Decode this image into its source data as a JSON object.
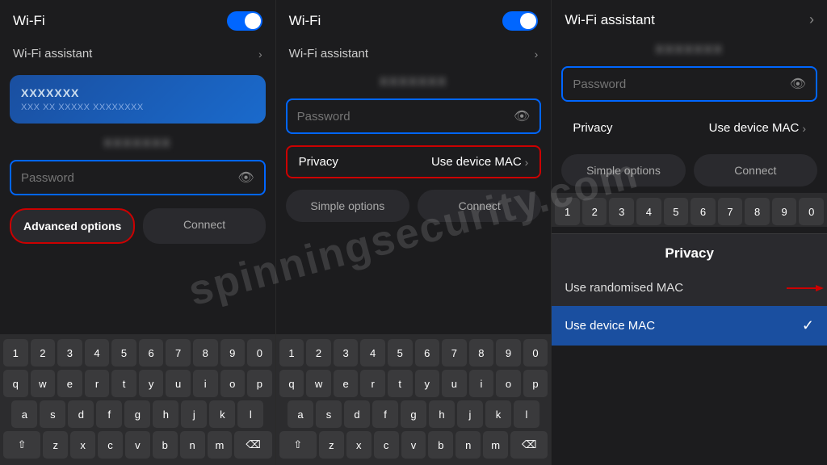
{
  "watermark": "spinningsecurity.com",
  "panel1": {
    "top_bar_title": "Wi-Fi",
    "assistant_label": "Wi-Fi assistant",
    "network_name": "XXXXXXX",
    "network_sub": "XXX XX XXXXX XXXXXXXX",
    "password_placeholder": "Password",
    "advanced_options_label": "Advanced options",
    "connect_label": "Connect",
    "numbers": [
      "1",
      "2",
      "3",
      "4",
      "5",
      "6",
      "7",
      "8",
      "9",
      "0"
    ],
    "row2": [
      "q",
      "w",
      "e",
      "r",
      "t",
      "y",
      "u",
      "i",
      "o",
      "p"
    ],
    "row3": [
      "a",
      "s",
      "d",
      "f",
      "g",
      "h",
      "j",
      "k",
      "l"
    ],
    "row4": [
      "z",
      "x",
      "c",
      "v",
      "b",
      "n",
      "m"
    ]
  },
  "panel2": {
    "top_bar_title": "Wi-Fi",
    "assistant_label": "Wi-Fi assistant",
    "network_name": "XXXXXXX",
    "password_placeholder": "Password",
    "privacy_label": "Privacy",
    "privacy_value": "Use device MAC",
    "simple_options_label": "Simple options",
    "connect_label": "Connect",
    "numbers": [
      "1",
      "2",
      "3",
      "4",
      "5",
      "6",
      "7",
      "8",
      "9",
      "0"
    ],
    "row2": [
      "q",
      "w",
      "e",
      "r",
      "t",
      "y",
      "u",
      "i",
      "o",
      "p"
    ],
    "row3": [
      "a",
      "s",
      "d",
      "f",
      "g",
      "h",
      "j",
      "k",
      "l"
    ],
    "row4": [
      "z",
      "x",
      "c",
      "v",
      "b",
      "n",
      "m"
    ]
  },
  "panel3": {
    "top_bar_title": "Wi-Fi assistant",
    "network_name": "XXXXXXX",
    "password_placeholder": "Password",
    "privacy_label": "Privacy",
    "privacy_value": "Use device MAC",
    "simple_options_label": "Simple options",
    "connect_label": "Connect",
    "privacy_section_title": "Privacy",
    "option_randomised": "Use randomised MAC",
    "option_device": "Use device MAC",
    "numbers": [
      "1",
      "2",
      "3",
      "4",
      "5",
      "6",
      "7",
      "8",
      "9",
      "0"
    ]
  },
  "colors": {
    "accent": "#0066ff",
    "highlight": "#cc0000",
    "selected_bg": "#1a4fa0"
  }
}
